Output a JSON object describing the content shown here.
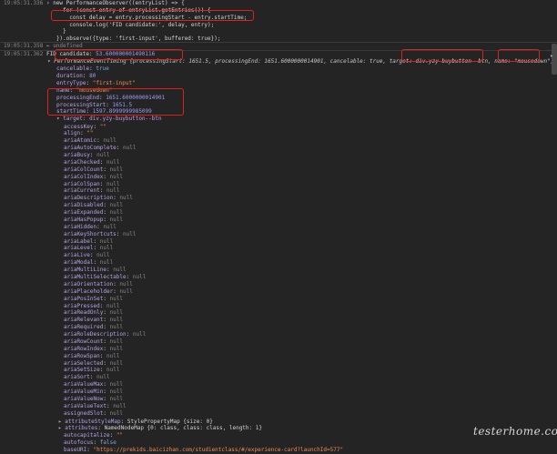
{
  "header": [
    {
      "ts": "19:05:31.336",
      "code": "new PerformanceObserver((entryList) => {"
    },
    {
      "ts": "",
      "code": "  for (const entry of entryList.getEntries()) {"
    },
    {
      "ts": "",
      "code": "    const delay = entry.processingStart - entry.startTime;"
    },
    {
      "ts": "",
      "code": "    console.log('FID candidate:', delay, entry);"
    },
    {
      "ts": "",
      "code": "  }"
    },
    {
      "ts": "",
      "code": "}).observe({type: 'first-input', buffered: true});"
    }
  ],
  "result_line": {
    "ts": "19:05:31.358",
    "arrow": "←",
    "value": "undefined"
  },
  "fid_line": {
    "ts": "19:05:31.362",
    "label": "FID candidate:",
    "delay": "53.600000001490116",
    "entry_summary": "PerformanceEventTiming {processingStart: 1651.5, processingEnd: 1651.6000000014901, cancelable: true, target: div.yzy-buybutton--btn, name: \"mousedown\", …}",
    "target_val": "div.yzy-buybutton--btn",
    "name_val": "\"mousedown\""
  },
  "entry_props": [
    {
      "k": "cancelable",
      "v": "true",
      "t": "kw"
    },
    {
      "k": "duration",
      "v": "80",
      "t": "n"
    },
    {
      "k": "entryType",
      "v": "\"first-input\"",
      "t": "s"
    },
    {
      "k": "name",
      "v": "\"mousedown\"",
      "t": "s"
    },
    {
      "k": "processingEnd",
      "v": "1651.6000000014901",
      "t": "n"
    },
    {
      "k": "processingStart",
      "v": "1651.5",
      "t": "n"
    },
    {
      "k": "startTime",
      "v": "1597.8999999985099",
      "t": "n"
    }
  ],
  "target_header": "target: div.yzy-buybutton--btn",
  "target_props": [
    {
      "k": "accessKey",
      "v": "\"\"",
      "t": "s"
    },
    {
      "k": "align",
      "v": "\"\"",
      "t": "s"
    },
    {
      "k": "ariaAtomic",
      "v": "null",
      "t": "nul"
    },
    {
      "k": "ariaAutoComplete",
      "v": "null",
      "t": "nul"
    },
    {
      "k": "ariaBusy",
      "v": "null",
      "t": "nul"
    },
    {
      "k": "ariaChecked",
      "v": "null",
      "t": "nul"
    },
    {
      "k": "ariaColCount",
      "v": "null",
      "t": "nul"
    },
    {
      "k": "ariaColIndex",
      "v": "null",
      "t": "nul"
    },
    {
      "k": "ariaColSpan",
      "v": "null",
      "t": "nul"
    },
    {
      "k": "ariaCurrent",
      "v": "null",
      "t": "nul"
    },
    {
      "k": "ariaDescription",
      "v": "null",
      "t": "nul"
    },
    {
      "k": "ariaDisabled",
      "v": "null",
      "t": "nul"
    },
    {
      "k": "ariaExpanded",
      "v": "null",
      "t": "nul"
    },
    {
      "k": "ariaHasPopup",
      "v": "null",
      "t": "nul"
    },
    {
      "k": "ariaHidden",
      "v": "null",
      "t": "nul"
    },
    {
      "k": "ariaKeyShortcuts",
      "v": "null",
      "t": "nul"
    },
    {
      "k": "ariaLabel",
      "v": "null",
      "t": "nul"
    },
    {
      "k": "ariaLevel",
      "v": "null",
      "t": "nul"
    },
    {
      "k": "ariaLive",
      "v": "null",
      "t": "nul"
    },
    {
      "k": "ariaModal",
      "v": "null",
      "t": "nul"
    },
    {
      "k": "ariaMultiLine",
      "v": "null",
      "t": "nul"
    },
    {
      "k": "ariaMultiSelectable",
      "v": "null",
      "t": "nul"
    },
    {
      "k": "ariaOrientation",
      "v": "null",
      "t": "nul"
    },
    {
      "k": "ariaPlaceholder",
      "v": "null",
      "t": "nul"
    },
    {
      "k": "ariaPosInSet",
      "v": "null",
      "t": "nul"
    },
    {
      "k": "ariaPressed",
      "v": "null",
      "t": "nul"
    },
    {
      "k": "ariaReadOnly",
      "v": "null",
      "t": "nul"
    },
    {
      "k": "ariaRelevant",
      "v": "null",
      "t": "nul"
    },
    {
      "k": "ariaRequired",
      "v": "null",
      "t": "nul"
    },
    {
      "k": "ariaRoleDescription",
      "v": "null",
      "t": "nul"
    },
    {
      "k": "ariaRowCount",
      "v": "null",
      "t": "nul"
    },
    {
      "k": "ariaRowIndex",
      "v": "null",
      "t": "nul"
    },
    {
      "k": "ariaRowSpan",
      "v": "null",
      "t": "nul"
    },
    {
      "k": "ariaSelected",
      "v": "null",
      "t": "nul"
    },
    {
      "k": "ariaSetSize",
      "v": "null",
      "t": "nul"
    },
    {
      "k": "ariaSort",
      "v": "null",
      "t": "nul"
    },
    {
      "k": "ariaValueMax",
      "v": "null",
      "t": "nul"
    },
    {
      "k": "ariaValueMin",
      "v": "null",
      "t": "nul"
    },
    {
      "k": "ariaValueNow",
      "v": "null",
      "t": "nul"
    },
    {
      "k": "ariaValueText",
      "v": "null",
      "t": "nul"
    },
    {
      "k": "assignedSlot",
      "v": "null",
      "t": "nul"
    }
  ],
  "tail_props": [
    {
      "exp": true,
      "k": "attributeStyleMap",
      "v": "StylePropertyMap {size: 0}",
      "t": "plain"
    },
    {
      "exp": true,
      "k": "attributes",
      "v": "NamedNodeMap {0: class, class: class, length: 1}",
      "t": "plain"
    },
    {
      "exp": false,
      "k": "autocapitalize",
      "v": "\"\"",
      "t": "s"
    },
    {
      "exp": false,
      "k": "autofocus",
      "v": "false",
      "t": "kw"
    },
    {
      "exp": false,
      "k": "baseURI",
      "v": "\"https://prekids.baicizhan.com/studientclass/#/experience-card?launchId=577\"",
      "t": "s"
    }
  ],
  "watermark": "testerhome.com",
  "right_marker": "▸"
}
